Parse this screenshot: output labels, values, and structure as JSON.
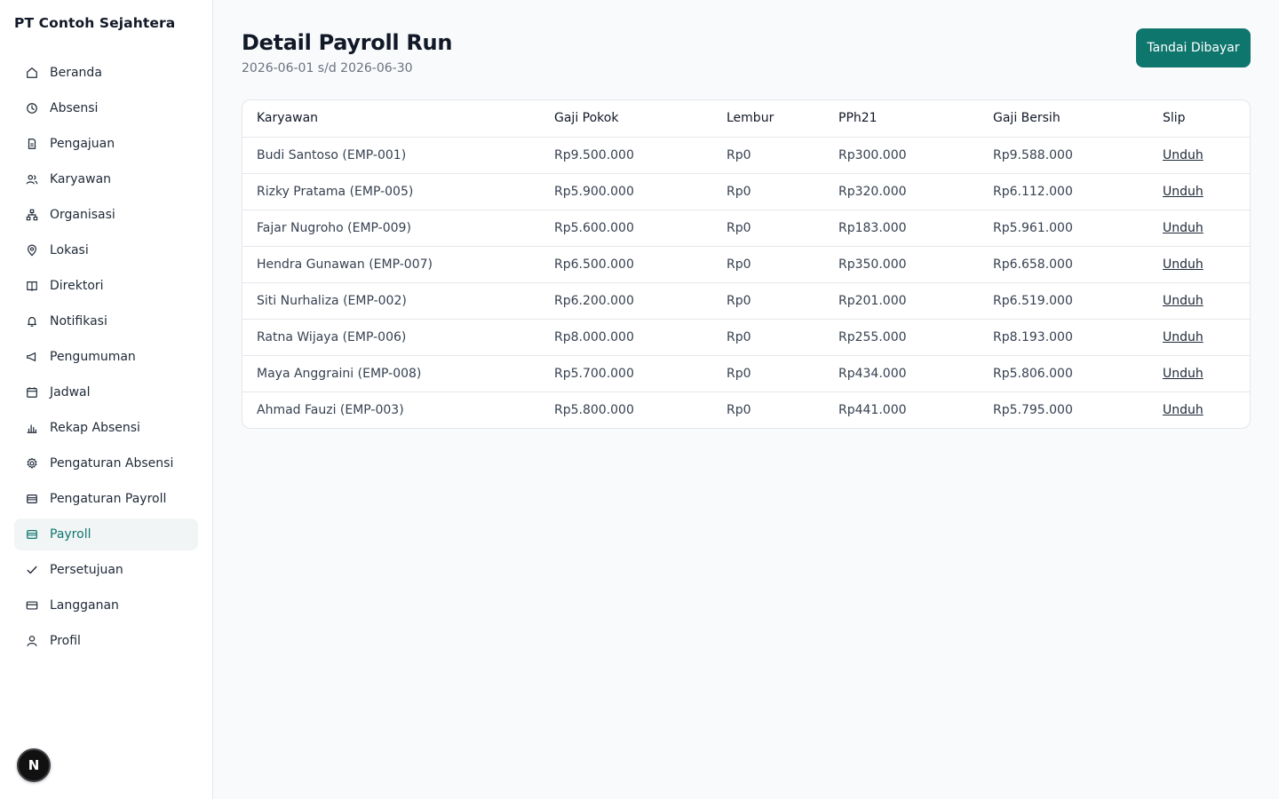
{
  "brand": "PT Contoh Sejahtera",
  "sidebar": {
    "items": [
      {
        "label": "Beranda",
        "icon": "home-icon"
      },
      {
        "label": "Absensi",
        "icon": "clock-icon"
      },
      {
        "label": "Pengajuan",
        "icon": "document-icon"
      },
      {
        "label": "Karyawan",
        "icon": "users-icon"
      },
      {
        "label": "Organisasi",
        "icon": "org-chart-icon"
      },
      {
        "label": "Lokasi",
        "icon": "map-pin-icon"
      },
      {
        "label": "Direktori",
        "icon": "book-icon"
      },
      {
        "label": "Notifikasi",
        "icon": "bell-icon"
      },
      {
        "label": "Pengumuman",
        "icon": "megaphone-icon"
      },
      {
        "label": "Jadwal",
        "icon": "calendar-icon"
      },
      {
        "label": "Rekap Absensi",
        "icon": "bar-chart-icon"
      },
      {
        "label": "Pengaturan Absensi",
        "icon": "gear-icon"
      },
      {
        "label": "Pengaturan Payroll",
        "icon": "wallet-icon"
      },
      {
        "label": "Payroll",
        "icon": "wallet-icon",
        "active": true
      },
      {
        "label": "Persetujuan",
        "icon": "check-icon"
      },
      {
        "label": "Langganan",
        "icon": "credit-card-icon"
      },
      {
        "label": "Profil",
        "icon": "user-icon"
      }
    ]
  },
  "avatar_letter": "N",
  "page": {
    "title": "Detail Payroll Run",
    "period": "2026-06-01 s/d 2026-06-30",
    "mark_paid_label": "Tandai Dibayar"
  },
  "table": {
    "headers": [
      "Karyawan",
      "Gaji Pokok",
      "Lembur",
      "PPh21",
      "Gaji Bersih",
      "Slip"
    ],
    "rows": [
      [
        "Budi Santoso (EMP-001)",
        "Rp9.500.000",
        "Rp0",
        "Rp300.000",
        "Rp9.588.000",
        "Unduh"
      ],
      [
        "Rizky Pratama (EMP-005)",
        "Rp5.900.000",
        "Rp0",
        "Rp320.000",
        "Rp6.112.000",
        "Unduh"
      ],
      [
        "Fajar Nugroho (EMP-009)",
        "Rp5.600.000",
        "Rp0",
        "Rp183.000",
        "Rp5.961.000",
        "Unduh"
      ],
      [
        "Hendra Gunawan (EMP-007)",
        "Rp6.500.000",
        "Rp0",
        "Rp350.000",
        "Rp6.658.000",
        "Unduh"
      ],
      [
        "Siti Nurhaliza (EMP-002)",
        "Rp6.200.000",
        "Rp0",
        "Rp201.000",
        "Rp6.519.000",
        "Unduh"
      ],
      [
        "Ratna Wijaya (EMP-006)",
        "Rp8.000.000",
        "Rp0",
        "Rp255.000",
        "Rp8.193.000",
        "Unduh"
      ],
      [
        "Maya Anggraini (EMP-008)",
        "Rp5.700.000",
        "Rp0",
        "Rp434.000",
        "Rp5.806.000",
        "Unduh"
      ],
      [
        "Ahmad Fauzi (EMP-003)",
        "Rp5.800.000",
        "Rp0",
        "Rp441.000",
        "Rp5.795.000",
        "Unduh"
      ]
    ]
  },
  "colors": {
    "accent": "#0f766e",
    "active_bg": "#f1f5f5"
  }
}
